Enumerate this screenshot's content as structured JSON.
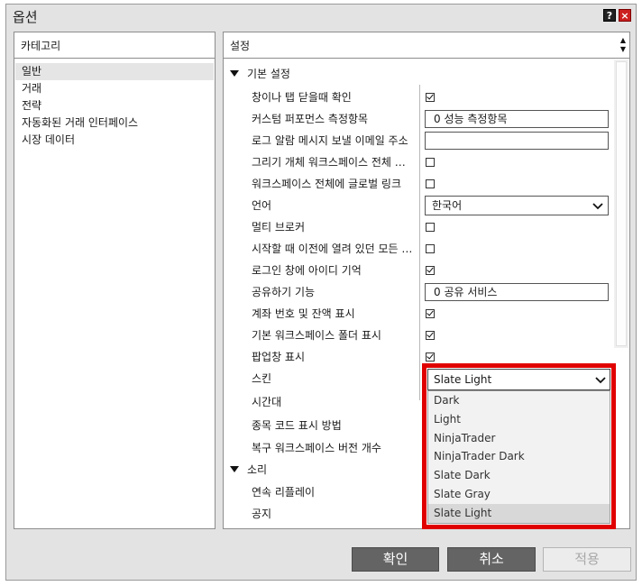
{
  "window": {
    "title": "옵션",
    "help_label": "?",
    "close_label": "×"
  },
  "categories": {
    "header": "카테고리",
    "items": [
      "일반",
      "거래",
      "전략",
      "자동화된 거래 인터페이스",
      "시장 데이터"
    ]
  },
  "settings": {
    "header": "설정",
    "sections": {
      "basic": "기본 설정",
      "sound": "소리"
    },
    "rows": [
      {
        "label": "창이나 탭 닫을때 확인",
        "control": "checkbox",
        "checked": true
      },
      {
        "label": "커스텀 퍼포먼스 측정항목",
        "control": "field",
        "value": "0 성능 측정항목"
      },
      {
        "label": "로그 알람 메시지 보낼 이메일 주소",
        "control": "field",
        "value": ""
      },
      {
        "label": "그리기 개체 워크스페이스 전체 적용",
        "control": "checkbox",
        "checked": false
      },
      {
        "label": "워크스페이스 전체에 글로벌 링크",
        "control": "checkbox",
        "checked": false
      },
      {
        "label": "언어",
        "control": "select",
        "value": "한국어"
      },
      {
        "label": "멀티 브로커",
        "control": "checkbox",
        "checked": false
      },
      {
        "label": "시작할 때 이전에 열려 있던 모든 워크스페이스",
        "control": "checkbox",
        "checked": false
      },
      {
        "label": "로그인 창에 아이디 기억",
        "control": "checkbox",
        "checked": true
      },
      {
        "label": "공유하기 기능",
        "control": "field",
        "value": "0 공유 서비스"
      },
      {
        "label": "계좌 번호 및 잔액 표시",
        "control": "checkbox",
        "checked": true
      },
      {
        "label": "기본 워크스페이스 폴더 표시",
        "control": "checkbox",
        "checked": true
      },
      {
        "label": "팝업창 표시",
        "control": "checkbox",
        "checked": true
      },
      {
        "label": "스킨",
        "control": "skin"
      },
      {
        "label": "시간대",
        "control": "none"
      },
      {
        "label": "종목 코드 표시 방법",
        "control": "none"
      },
      {
        "label": "복구 워크스페이스 버전 개수",
        "control": "none"
      }
    ],
    "sound_rows": [
      {
        "label": "연속 리플레이"
      },
      {
        "label": "공지"
      }
    ],
    "skin": {
      "value": "Slate Light",
      "options": [
        "Dark",
        "Light",
        "NinjaTrader",
        "NinjaTrader Dark",
        "Slate Dark",
        "Slate Gray",
        "Slate Light"
      ],
      "selected_index": 6
    }
  },
  "buttons": {
    "ok": "확인",
    "cancel": "취소",
    "apply": "적용"
  },
  "colors": {
    "highlight_frame": "#e00000",
    "button_dark": "#646464"
  }
}
